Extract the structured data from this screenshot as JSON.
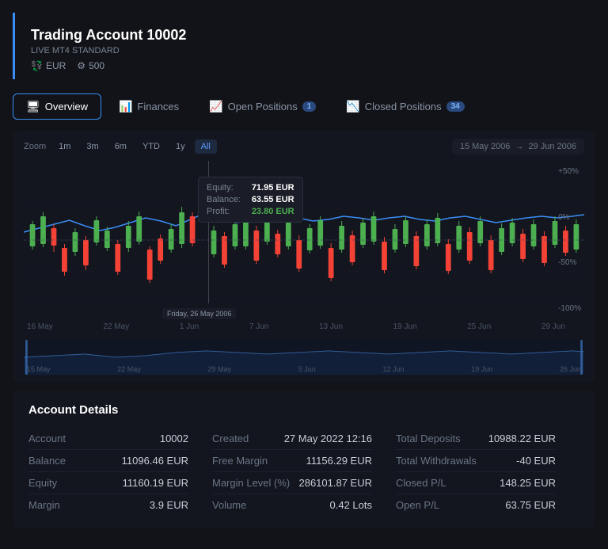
{
  "header": {
    "title": "Trading Account 10002",
    "subtitle": "LIVE MT4 STANDARD",
    "currency": "EUR",
    "leverage": "500"
  },
  "nav": {
    "items": [
      {
        "id": "overview",
        "label": "Overview",
        "icon": "🖥",
        "active": true,
        "badge": null
      },
      {
        "id": "finances",
        "label": "Finances",
        "icon": "📊",
        "active": false,
        "badge": null
      },
      {
        "id": "open-positions",
        "label": "Open Positions",
        "icon": "📈",
        "active": false,
        "badge": "1"
      },
      {
        "id": "closed-positions",
        "label": "Closed Positions",
        "icon": "📉",
        "active": false,
        "badge": "34"
      }
    ]
  },
  "chart": {
    "zoom_label": "Zoom",
    "zoom_options": [
      "1m",
      "3m",
      "6m",
      "YTD",
      "1y",
      "All"
    ],
    "zoom_active": "All",
    "date_from": "15 May 2006",
    "date_to": "29 Jun 2006",
    "date_arrow": "→",
    "tooltip": {
      "equity_label": "Equity:",
      "equity_value": "71.95 EUR",
      "balance_label": "Balance:",
      "balance_value": "63.55 EUR",
      "profit_label": "Profit:",
      "profit_value": "23.80 EUR"
    },
    "cursor_date": "Friday, 26 May 2006",
    "x_labels": [
      "16 May",
      "22 May",
      "1 Jun",
      "7 Jun",
      "13 Jun",
      "19 Jun",
      "25 Jun",
      "29 Jun"
    ],
    "mini_x_labels": [
      "15 May",
      "22 May",
      "29 May",
      "5 Jun",
      "12 Jun",
      "19 Jun",
      "26 Jun"
    ],
    "y_labels": [
      "+50%",
      "0%",
      "-50%",
      "-100%"
    ]
  },
  "account_details": {
    "title": "Account Details",
    "columns": [
      {
        "rows": [
          {
            "label": "Account",
            "value": "10002"
          },
          {
            "label": "Balance",
            "value": "11096.46 EUR"
          },
          {
            "label": "Equity",
            "value": "11160.19 EUR"
          },
          {
            "label": "Margin",
            "value": "3.9 EUR"
          }
        ]
      },
      {
        "rows": [
          {
            "label": "Created",
            "value": "27 May 2022 12:16"
          },
          {
            "label": "Free Margin",
            "value": "11156.29 EUR"
          },
          {
            "label": "Margin Level (%)",
            "value": "286101.87 EUR"
          },
          {
            "label": "Volume",
            "value": "0.42 Lots"
          }
        ]
      },
      {
        "rows": [
          {
            "label": "Total Deposits",
            "value": "10988.22 EUR"
          },
          {
            "label": "Total Withdrawals",
            "value": "-40  EUR"
          },
          {
            "label": "Closed P/L",
            "value": "148.25 EUR"
          },
          {
            "label": "Open P/L",
            "value": "63.75 EUR"
          }
        ]
      }
    ]
  }
}
